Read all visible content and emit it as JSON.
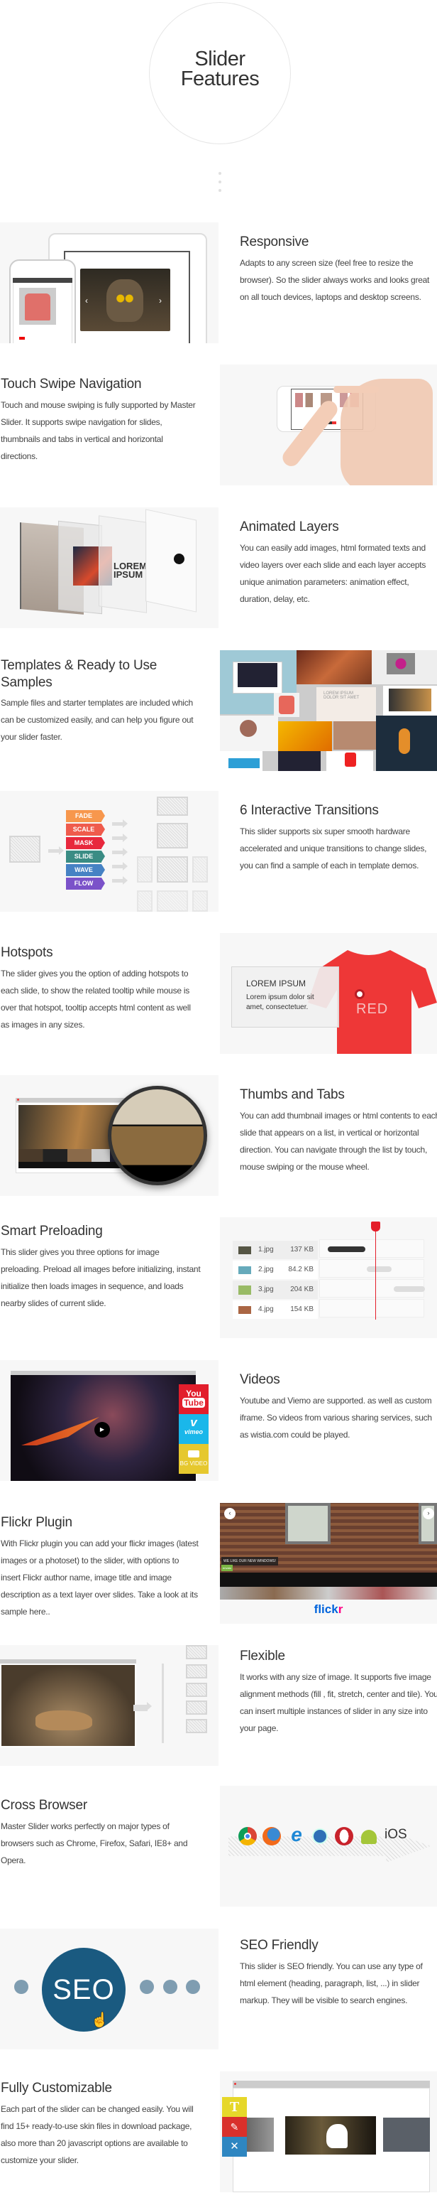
{
  "header": {
    "title_line1": "Slider",
    "title_line2": "Features"
  },
  "features": [
    {
      "title": "Responsive",
      "desc": "Adapts to any screen size (feel free to resize the browser). So the slider always works and looks great on all touch devices, laptops and desktop screens."
    },
    {
      "title": "Touch Swipe Navigation",
      "desc": "Touch and mouse swiping is fully supported by Master Slider. It supports swipe navigation for slides, thumbnails and tabs in vertical and horizontal directions."
    },
    {
      "title": "Animated Layers",
      "desc": "You can easily add images, html formated texts and video layers over each slide and each layer accepts unique animation parameters: animation effect, duration, delay, etc."
    },
    {
      "title": "Templates & Ready to Use Samples",
      "desc": "Sample files and starter templates are included which can be customized easily, and can help you figure out your slider faster."
    },
    {
      "title": "6 Interactive Transitions",
      "desc": "This slider supports six super smooth hardware accelerated and unique transitions to change slides, you can find a sample of each in template demos."
    },
    {
      "title": "Hotspots",
      "desc": "The slider gives you the option of adding hotspots to each slide, to show the related tooltip while mouse is over that hotspot, tooltip accepts html content as well as images in any sizes."
    },
    {
      "title": "Thumbs and Tabs",
      "desc": "You can add thumbnail images or html contents to each slide that appears on a list, in vertical or horizontal direction. You can navigate through the list by touch, mouse swiping or the mouse wheel."
    },
    {
      "title": "Smart Preloading",
      "desc": "This slider gives you three options for image preloading. Preload all images before initializing, instant initialize then loads images in sequence, and loads nearby slides of current slide."
    },
    {
      "title": "Videos",
      "desc": "Youtube and Viemo are supported.  as well as custom iframe. So videos from various sharing services, such as wistia.com could be played."
    },
    {
      "title": "Flickr Plugin",
      "desc": "With Flickr plugin you can add your flickr images (latest images or a photoset) to the slider, with options to insert Flickr author name, image title and image description as a text layer over slides. Take a look at its sample here.."
    },
    {
      "title": "Flexible",
      "desc": "It works with any size of image. It supports five image alignment methods (fill , fit, stretch, center and tile). You can insert multiple instances of slider in any size into your page."
    },
    {
      "title": "Cross Browser",
      "desc": "Master Slider works perfectly on major types of browsers such as Chrome, Firefox, Safari,  IE8+ and Opera."
    },
    {
      "title": "SEO Friendly",
      "desc": "This slider is SEO friendly. You can use any type of html element (heading, paragraph, list, ...) in slider markup. They will be visible to search engines."
    },
    {
      "title": "Fully Customizable",
      "desc": "Each part of the slider can be changed easily. You will find 15+ ready-to-use skin files in download package, also more than 20 javascript options are available to customize your slider."
    }
  ],
  "transitions": {
    "labels": [
      "FADE",
      "SCALE",
      "MASK",
      "SLIDE",
      "WAVE",
      "FLOW"
    ],
    "colors": [
      "#f7974d",
      "#ef5b4c",
      "#e8283d",
      "#3a8c84",
      "#4682c4",
      "#7b52c9"
    ]
  },
  "hotspot": {
    "tooltip_title": "LOREM IPSUM",
    "tooltip_text": "Lorem ipsum dolor sit amet, consectetuer.",
    "shirt_text": "RED"
  },
  "preload": {
    "rows": [
      {
        "file": "1.jpg",
        "size": "137 KB"
      },
      {
        "file": "2.jpg",
        "size": "84.2 KB"
      },
      {
        "file": "3.jpg",
        "size": "204 KB"
      },
      {
        "file": "4.jpg",
        "size": "154 KB"
      }
    ]
  },
  "videos": {
    "youtube_1": "You",
    "youtube_2": "Tube",
    "vimeo": "vimeo",
    "bgvideo": "BG VIDEO"
  },
  "flickr": {
    "caption": "WE LIKE OUR NEW WINDOWS!",
    "tag": "envato",
    "logo_a": "flick",
    "logo_b": "r"
  },
  "browsers": {
    "ios": "iOS",
    "icons": [
      "chrome-icon",
      "firefox-icon",
      "ie-icon",
      "safari-icon",
      "opera-icon",
      "android-icon"
    ]
  },
  "seo": {
    "label": "SEO"
  },
  "customize": {
    "text_tool": "T"
  },
  "colors": {
    "accent_seo": "#1a5a80",
    "youtube": "#e21e2c",
    "vimeo": "#1ab7ea",
    "bgvideo": "#e6c82e",
    "flickr_blue": "#0063dc",
    "flickr_pink": "#ff0084"
  }
}
